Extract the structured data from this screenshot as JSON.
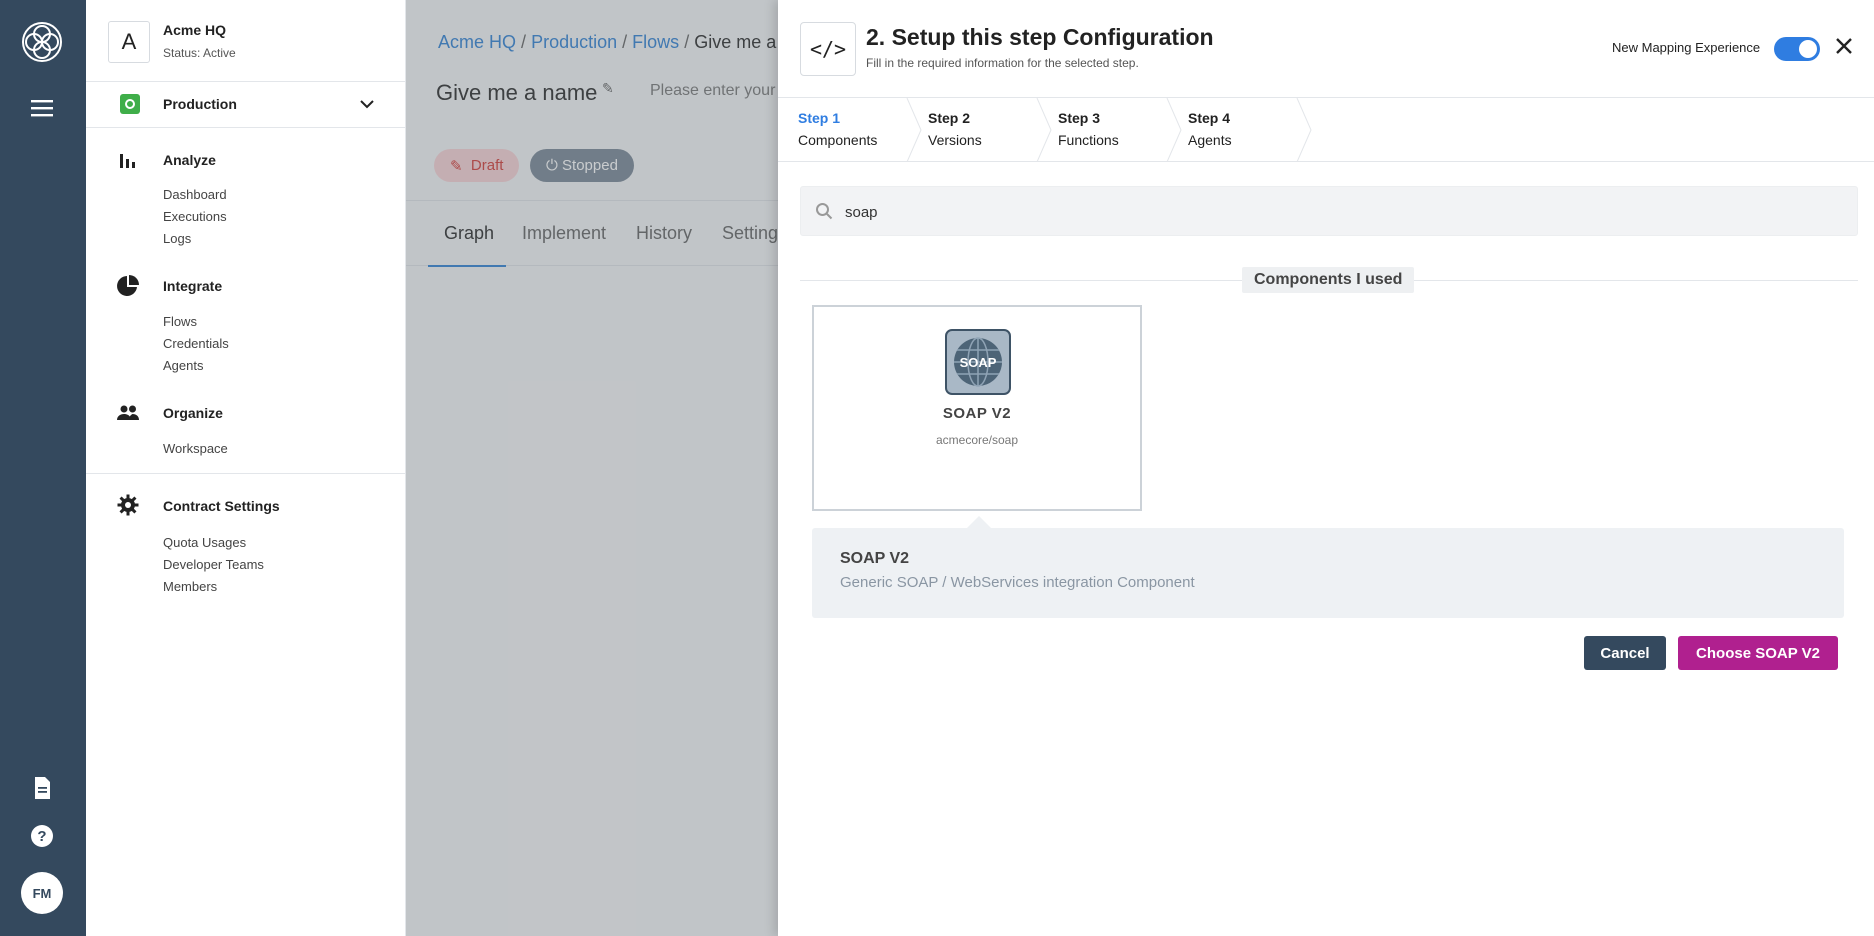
{
  "rail": {
    "avatar_initials": "FM"
  },
  "sidebar": {
    "workspace": {
      "letter": "A",
      "name": "Acme HQ",
      "status": "Status: Active"
    },
    "context": {
      "label": "Production"
    },
    "sections": [
      {
        "title": "Analyze",
        "items": [
          "Dashboard",
          "Executions",
          "Logs"
        ]
      },
      {
        "title": "Integrate",
        "items": [
          "Flows",
          "Credentials",
          "Agents"
        ]
      },
      {
        "title": "Organize",
        "items": [
          "Workspace"
        ]
      },
      {
        "title": "Contract Settings",
        "items": [
          "Quota Usages",
          "Developer Teams",
          "Members"
        ]
      }
    ]
  },
  "background": {
    "breadcrumb": [
      "Acme HQ",
      "Production",
      "Flows",
      "Give me a na"
    ],
    "breadcrumb_sep": "/",
    "flow_name": "Give me a name",
    "description_placeholder": "Please enter your",
    "draft_label": "Draft",
    "stopped_label": "Stopped",
    "tabs": [
      "Graph",
      "Implement",
      "History",
      "Settings"
    ]
  },
  "modal": {
    "title": "2. Setup this step Configuration",
    "subtitle": "Fill in the required information for the selected step.",
    "toggle_label": "New Mapping Experience",
    "toggle_on": true,
    "steps": [
      {
        "num": "Step 1",
        "name": "Components"
      },
      {
        "num": "Step 2",
        "name": "Versions"
      },
      {
        "num": "Step 3",
        "name": "Functions"
      },
      {
        "num": "Step 4",
        "name": "Agents"
      }
    ],
    "search_value": "soap",
    "group_label": "Components I used",
    "component": {
      "logo_text": "SOAP",
      "title": "SOAP V2",
      "slug": "acmecore/soap"
    },
    "detail": {
      "title": "SOAP V2",
      "description": "Generic SOAP / WebServices integration Component"
    },
    "cancel_label": "Cancel",
    "choose_label": "Choose SOAP V2"
  },
  "colors": {
    "rail": "#34495e",
    "accent_blue": "#2f7de1",
    "choose_button": "#b0208f",
    "production_dot": "#3fae49"
  }
}
